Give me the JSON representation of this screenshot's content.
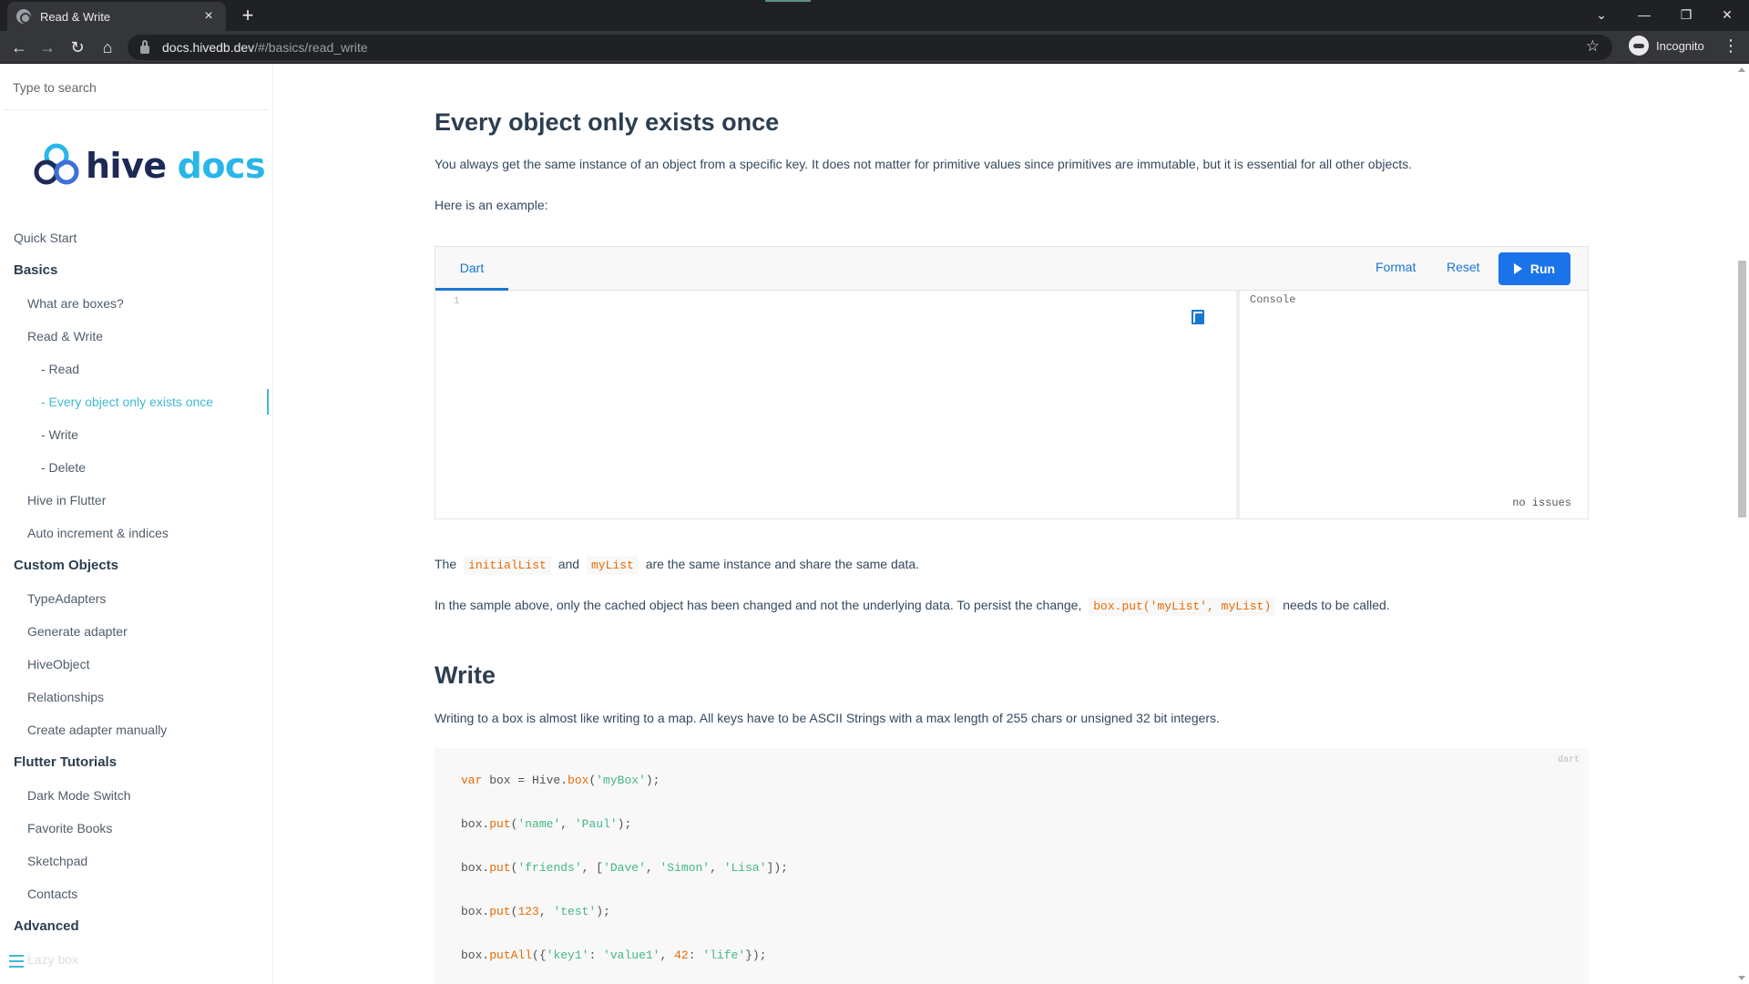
{
  "browser": {
    "tab_title": "Read & Write",
    "tab_close": "×",
    "new_tab": "+",
    "url_host": "docs.hivedb.dev",
    "url_path": "/#/basics/read_write",
    "profile_label": "Incognito",
    "back_icon": "←",
    "forward_icon": "→",
    "reload_icon": "↻",
    "home_icon": "⌂",
    "star_icon": "☆",
    "menu_icon": "⋮",
    "dropdown_icon": "⌄",
    "minimize_icon": "—",
    "restore_icon": "❐",
    "close_icon": "✕"
  },
  "sidebar": {
    "search_placeholder": "Type to search",
    "logo_hive": "hive",
    "logo_docs": "docs",
    "items": [
      {
        "label": "Quick Start",
        "level": "l0"
      },
      {
        "label": "Basics",
        "level": "group"
      },
      {
        "label": "What are boxes?",
        "level": "l1"
      },
      {
        "label": "Read & Write",
        "level": "l1"
      },
      {
        "label": "- Read",
        "level": "l2"
      },
      {
        "label": "- Every object only exists once",
        "level": "l2",
        "active": true
      },
      {
        "label": "- Write",
        "level": "l2"
      },
      {
        "label": "- Delete",
        "level": "l2"
      },
      {
        "label": "Hive in Flutter",
        "level": "l1"
      },
      {
        "label": "Auto increment & indices",
        "level": "l1"
      },
      {
        "label": "Custom Objects",
        "level": "group"
      },
      {
        "label": "TypeAdapters",
        "level": "l1"
      },
      {
        "label": "Generate adapter",
        "level": "l1"
      },
      {
        "label": "HiveObject",
        "level": "l1"
      },
      {
        "label": "Relationships",
        "level": "l1"
      },
      {
        "label": "Create adapter manually",
        "level": "l1"
      },
      {
        "label": "Flutter Tutorials",
        "level": "group"
      },
      {
        "label": "Dark Mode Switch",
        "level": "l1"
      },
      {
        "label": "Favorite Books",
        "level": "l1"
      },
      {
        "label": "Sketchpad",
        "level": "l1"
      },
      {
        "label": "Contacts",
        "level": "l1"
      },
      {
        "label": "Advanced",
        "level": "group"
      },
      {
        "label": "Lazy box",
        "level": "l1",
        "faded": true
      }
    ]
  },
  "main": {
    "section1_title": "Every object only exists once",
    "section1_p1": "You always get the same instance of an object from a specific key. It does not matter for primitive values since primitives are immutable, but it is essential for all other objects.",
    "section1_p2": "Here is an example:",
    "dartpad": {
      "tab_label": "Dart",
      "format_label": "Format",
      "reset_label": "Reset",
      "run_label": "Run",
      "line_number": "1",
      "console_label": "Console",
      "issues_label": "no issues"
    },
    "p3_prefix": "The",
    "p3_code1": "initialList",
    "p3_mid": "and",
    "p3_code2": "myList",
    "p3_suffix": "are the same instance and share the same data.",
    "p4_prefix": "In the sample above, only the cached object has been changed and not the underlying data. To persist the change,",
    "p4_code": "box.put('myList', myList)",
    "p4_suffix": "needs to be called.",
    "section2_title": "Write",
    "section2_p1": "Writing to a box is almost like writing to a map. All keys have to be ASCII Strings with a max length of 255 chars or unsigned 32 bit integers.",
    "code_lang": "dart",
    "code": {
      "l1_kw": "var",
      "l1_a": " box = Hive.",
      "l1_fn": "box",
      "l1_b": "(",
      "l1_s": "'myBox'",
      "l1_c": ");",
      "l2_a": "box.",
      "l2_fn": "put",
      "l2_b": "(",
      "l2_s1": "'name'",
      "l2_c": ", ",
      "l2_s2": "'Paul'",
      "l2_d": ");",
      "l3_a": "box.",
      "l3_fn": "put",
      "l3_b": "(",
      "l3_s1": "'friends'",
      "l3_c": ", [",
      "l3_s2": "'Dave'",
      "l3_d": ", ",
      "l3_s3": "'Simon'",
      "l3_e": ", ",
      "l3_s4": "'Lisa'",
      "l3_f": "]);",
      "l4_a": "box.",
      "l4_fn": "put",
      "l4_b": "(",
      "l4_n": "123",
      "l4_c": ", ",
      "l4_s": "'test'",
      "l4_d": ");",
      "l5_a": "box.",
      "l5_fn": "putAll",
      "l5_b": "({",
      "l5_s1": "'key1'",
      "l5_c": ": ",
      "l5_s2": "'value1'",
      "l5_d": ", ",
      "l5_n": "42",
      "l5_e": ": ",
      "l5_s3": "'life'",
      "l5_f": "});"
    }
  },
  "colors": {
    "accent": "#42b9d0",
    "code_orange": "#e96900",
    "code_string": "#42b983",
    "run_button": "#1a73e8"
  }
}
